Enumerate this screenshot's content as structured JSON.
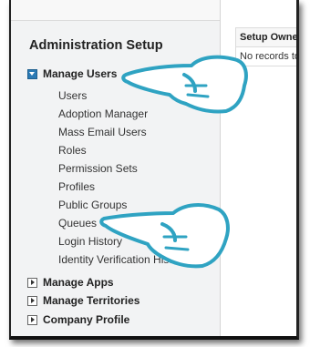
{
  "sidebar": {
    "title": "Administration Setup",
    "manage_users": {
      "label": "Manage Users",
      "items": [
        {
          "label": "Users"
        },
        {
          "label": "Adoption Manager"
        },
        {
          "label": "Mass Email Users"
        },
        {
          "label": "Roles"
        },
        {
          "label": "Permission Sets"
        },
        {
          "label": "Profiles"
        },
        {
          "label": "Public Groups"
        },
        {
          "label": "Queues"
        },
        {
          "label": "Login History"
        },
        {
          "label": "Identity Verification History"
        }
      ]
    },
    "collapsed_sections": [
      {
        "label": "Manage Apps"
      },
      {
        "label": "Manage Territories"
      },
      {
        "label": "Company Profile"
      }
    ]
  },
  "main": {
    "table_header": "Setup Owner",
    "empty_text": "No records to display"
  },
  "colors": {
    "accent_blue": "#2a7ab5",
    "pointer_teal": "#2fa3c2"
  },
  "icons": [
    "expanded-square-icon",
    "collapsed-square-icon",
    "pointing-hand-icon"
  ]
}
